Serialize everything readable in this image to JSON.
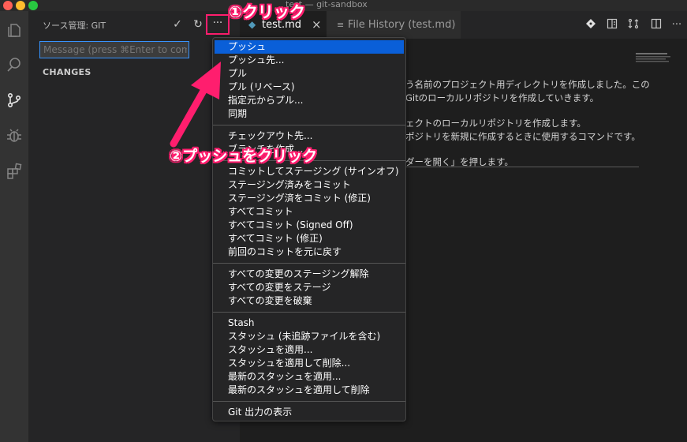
{
  "window": {
    "title": "test — git-sandbox"
  },
  "colors": {
    "accent": "#0a5fd8",
    "annotation": "#ff1e6e",
    "focus": "#3794ff"
  },
  "sidebar": {
    "title": "ソース管理: GIT",
    "actions": {
      "commit": "✓",
      "refresh": "↻",
      "more": "···"
    },
    "commit_placeholder": "Message (press ⌘Enter to commit)",
    "changes_label": "CHANGES"
  },
  "tabs": [
    {
      "label": "test.md",
      "close": "×"
    },
    {
      "label": "File History (test.md)"
    }
  ],
  "editor": {
    "lines": [
      "う名前のプロジェクト用ディレクトリを作成しました。この",
      "Gitのローカルリポジトリを作成していきます。",
      "ェクトのローカルリポジトリを作成します。",
      "ポジトリを新規に作成するときに使用するコマンドです。",
      "ダーを開く」を押します。"
    ]
  },
  "menu": {
    "groups": [
      [
        "プッシュ",
        "プッシュ先...",
        "プル",
        "プル (リベース)",
        "指定元からプル...",
        "同期"
      ],
      [
        "チェックアウト先...",
        "ブランチを作成..."
      ],
      [
        "コミットしてステージング (サインオフ)",
        "ステージング済みをコミット",
        "ステージング済をコミット (修正)",
        "すべてコミット",
        "すべてコミット (Signed Off)",
        "すべてコミット (修正)",
        "前回のコミットを元に戻す"
      ],
      [
        "すべての変更のステージング解除",
        "すべての変更をステージ",
        "すべての変更を破棄"
      ],
      [
        "Stash",
        "スタッシュ (未追跡ファイルを含む)",
        "スタッシュを適用...",
        "スタッシュを適用して削除...",
        "最新のスタッシュを適用...",
        "最新のスタッシュを適用して削除"
      ],
      [
        "Git 出力の表示"
      ]
    ]
  },
  "annotations": {
    "step1": "①クリック",
    "step2": "②プッシュをクリック"
  }
}
